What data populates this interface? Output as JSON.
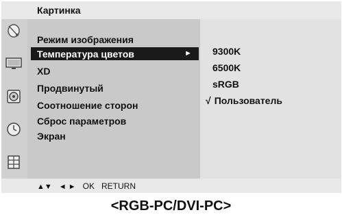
{
  "osd": {
    "title": "Картинка",
    "menu": {
      "items": [
        {
          "label": "Режим изображения"
        },
        {
          "label": "Температура цветов",
          "arrow": "►"
        },
        {
          "label": "XD"
        },
        {
          "label": "Продвинутый"
        },
        {
          "label": "Соотношение сторон"
        },
        {
          "label": "Сброс параметров"
        },
        {
          "label": "Экран"
        }
      ],
      "selected": "Температура цветов"
    },
    "submenu": {
      "items": [
        {
          "label": "9300K"
        },
        {
          "label": "6500K"
        },
        {
          "label": "sRGB"
        },
        {
          "label": "Пользователь",
          "check": "√"
        }
      ],
      "checked": "Пользователь"
    },
    "icons": [
      "satellite-dish-icon",
      "monitor-icon",
      "speaker-icon",
      "clock-icon",
      "lock-icon"
    ],
    "nav": {
      "arrows_updown": "▲▼",
      "arrows_leftright": "◄ ►",
      "ok": "OK",
      "return": "RETURN"
    },
    "colors": {
      "highlight_bg": "#1a1a1a",
      "highlight_text": "#ffffff",
      "menu_bg": "#c9c9c9",
      "submenu_bg": "#e2e2e2"
    }
  },
  "caption": "<RGB-PC/DVI-PC>"
}
